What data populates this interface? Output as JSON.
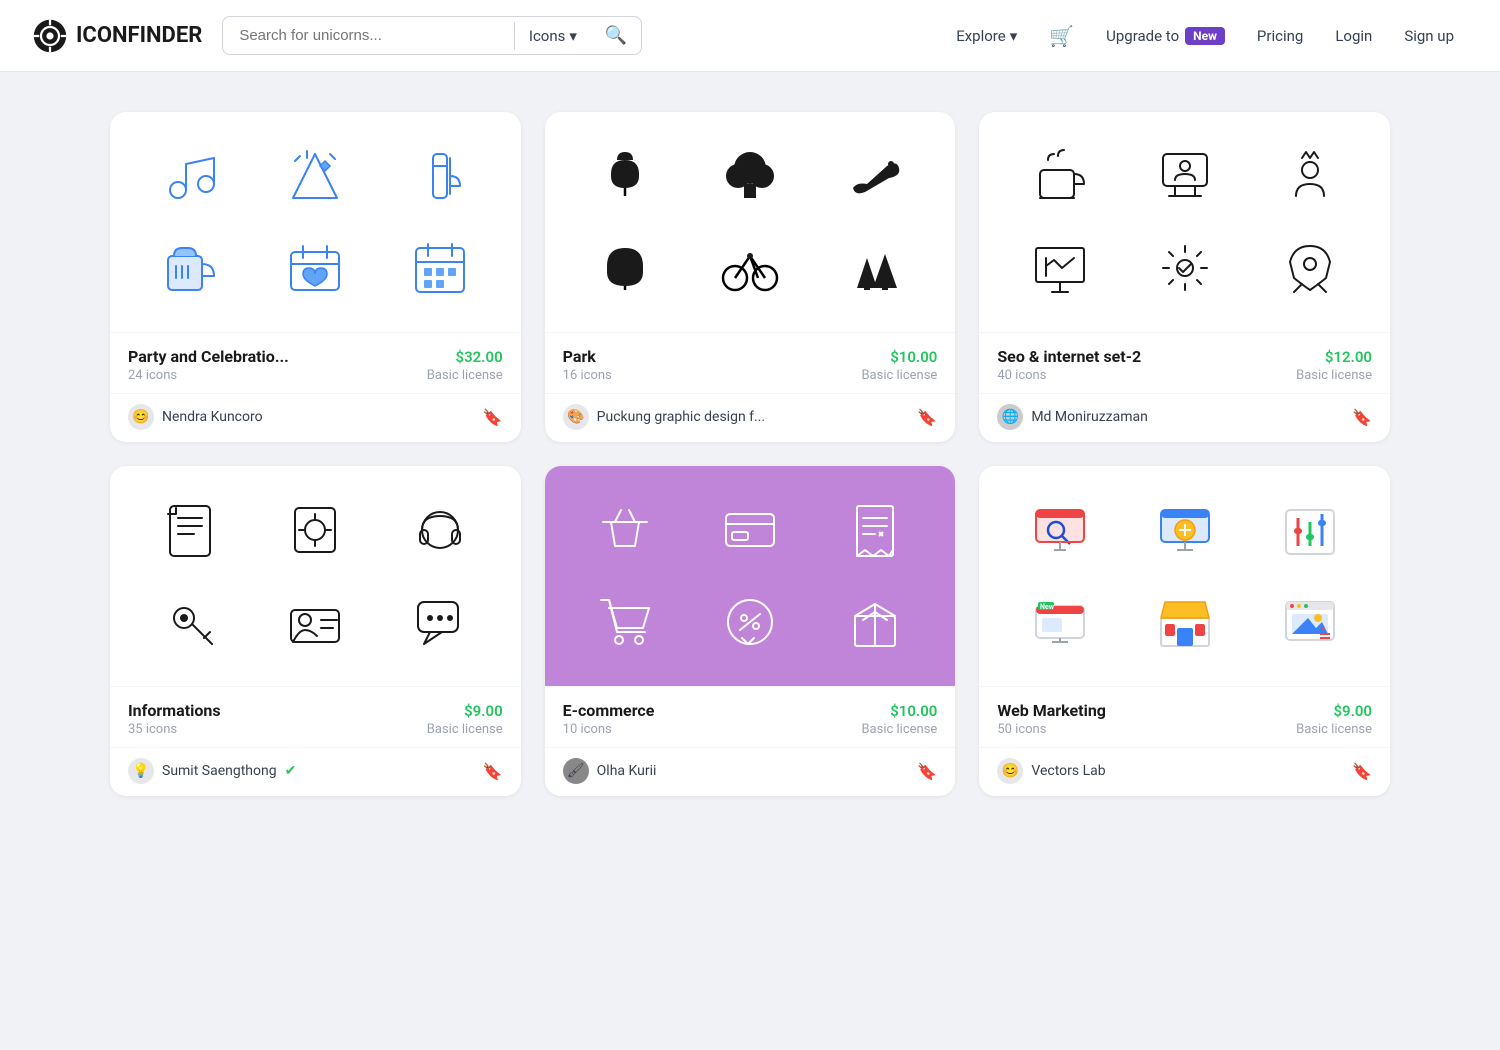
{
  "header": {
    "logo_text": "ICONFINDER",
    "search_placeholder": "Search for unicorns...",
    "search_type": "Icons",
    "nav_explore": "Explore",
    "nav_upgrade": "Upgrade to",
    "nav_new_badge": "New",
    "nav_pricing": "Pricing",
    "nav_login": "Login",
    "nav_signup": "Sign up"
  },
  "cards": [
    {
      "title": "Party and Celebratio...",
      "count": "24 icons",
      "price": "$32.00",
      "license": "Basic license",
      "author": "Nendra Kuncoro",
      "bg": "white"
    },
    {
      "title": "Park",
      "count": "16 icons",
      "price": "$10.00",
      "license": "Basic license",
      "author": "Puckung graphic design f...",
      "bg": "white"
    },
    {
      "title": "Seo & internet set-2",
      "count": "40 icons",
      "price": "$12.00",
      "license": "Basic license",
      "author": "Md Moniruzzaman",
      "bg": "white"
    },
    {
      "title": "Informations",
      "count": "35 icons",
      "price": "$9.00",
      "license": "Basic license",
      "author": "Sumit Saengthong",
      "bg": "white",
      "verified": true
    },
    {
      "title": "E-commerce",
      "count": "10 icons",
      "price": "$10.00",
      "license": "Basic license",
      "author": "Olha Kurii",
      "bg": "purple"
    },
    {
      "title": "Web Marketing",
      "count": "50 icons",
      "price": "$9.00",
      "license": "Basic license",
      "author": "Vectors Lab",
      "bg": "white"
    }
  ]
}
